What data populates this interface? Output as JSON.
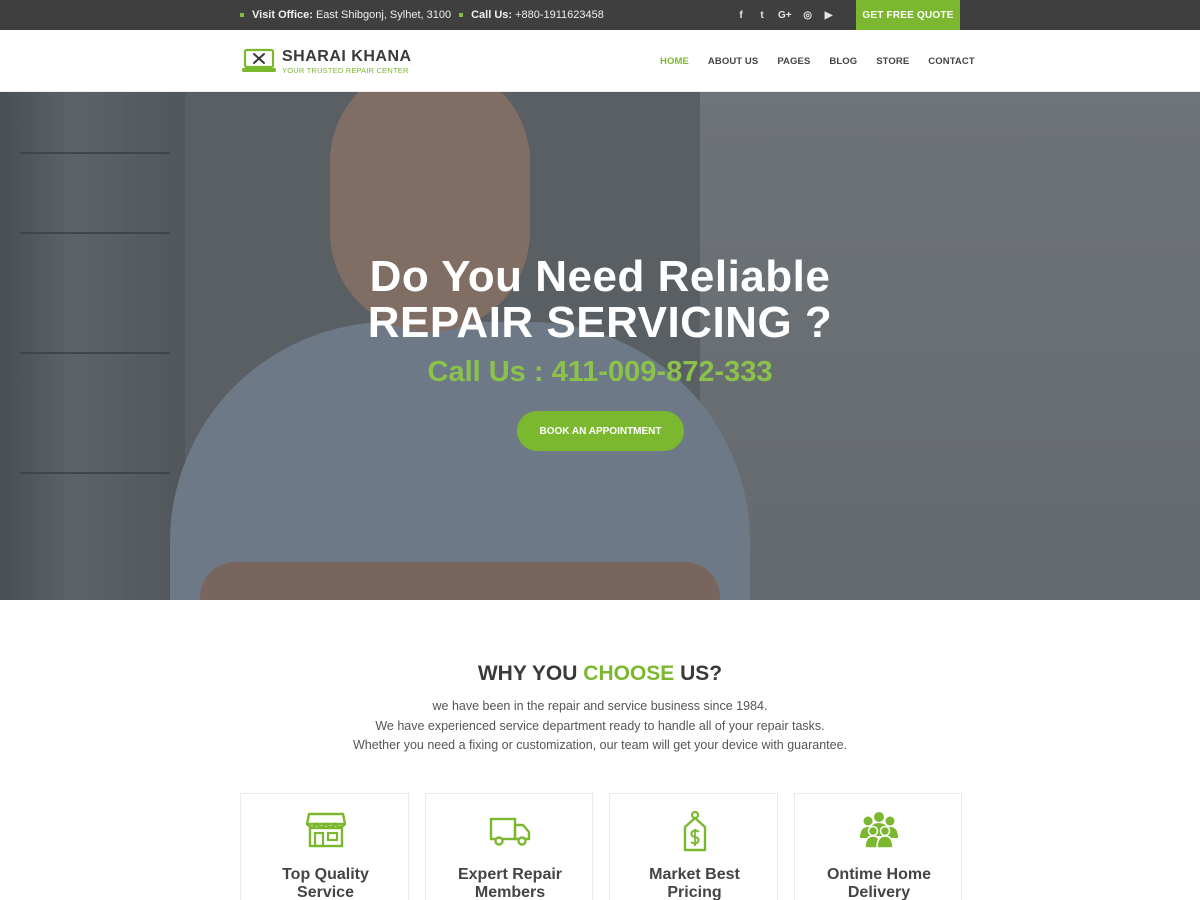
{
  "topbar": {
    "office_label": "Visit Office:",
    "office_value": "East Shibgonj, Sylhet, 3100",
    "call_label": "Call Us:",
    "call_value": "+880-1911623458",
    "social": [
      {
        "name": "facebook-icon",
        "glyph": "f"
      },
      {
        "name": "twitter-icon",
        "glyph": "t"
      },
      {
        "name": "google-plus-icon",
        "glyph": "G+"
      },
      {
        "name": "instagram-icon",
        "glyph": "◎"
      },
      {
        "name": "youtube-icon",
        "glyph": "▶"
      }
    ],
    "quote_button": "GET FREE QUOTE"
  },
  "header": {
    "logo_title": "SHARAI KHANA",
    "logo_subtitle": "YOUR TRUSTED REPAIR CENTER",
    "nav": [
      "HOME",
      "ABOUT US",
      "PAGES",
      "BLOG",
      "STORE",
      "CONTACT"
    ],
    "active_nav": "HOME"
  },
  "hero": {
    "line1": "Do You Need Reliable",
    "line2": "REPAIR SERVICING ?",
    "call": "Call Us : 411-009-872-333",
    "button": "BOOK AN APPOINTMENT"
  },
  "why": {
    "title_pre": "WHY YOU ",
    "title_accent": "CHOOSE",
    "title_post": " US?",
    "desc_lines": [
      "we have been in the repair and service business since 1984.",
      "We have experienced service department ready to handle all of your repair tasks.",
      "Whether you need a fixing or customization, our team will get your device with guarantee."
    ]
  },
  "features": [
    {
      "icon": "store-icon",
      "title_1": "Top Quality",
      "title_2": "Service"
    },
    {
      "icon": "truck-icon",
      "title_1": "Expert Repair",
      "title_2": "Members"
    },
    {
      "icon": "price-tag-icon",
      "title_1": "Market Best",
      "title_2": "Pricing"
    },
    {
      "icon": "team-icon",
      "title_1": "Ontime Home",
      "title_2": "Delivery"
    }
  ],
  "colors": {
    "accent": "#7cb82f",
    "topbar": "#3f3f3f",
    "hero_call": "#8bc34a"
  }
}
